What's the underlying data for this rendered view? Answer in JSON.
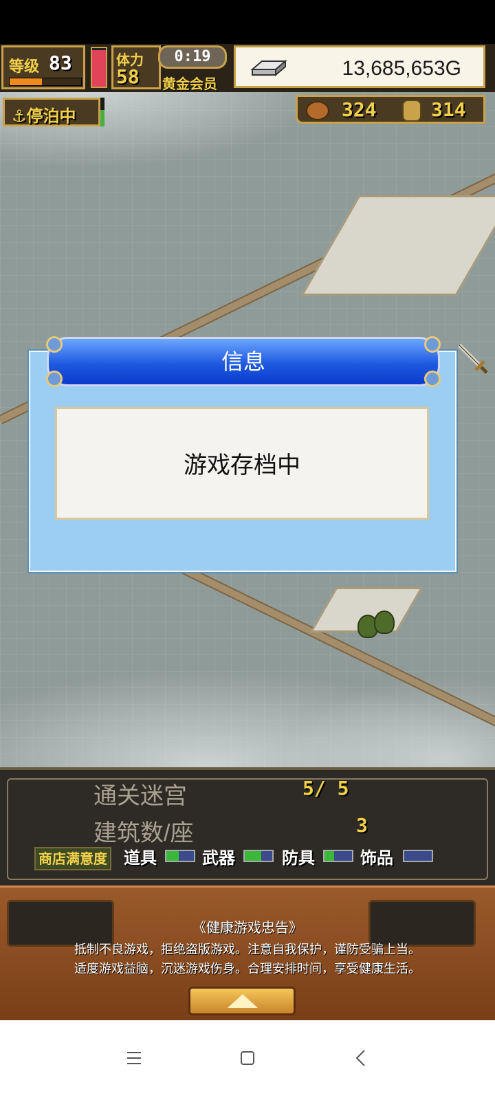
{
  "hud": {
    "level_label": "等级",
    "level": "83",
    "level_progress": 0.45,
    "hp_fraction": 0.95,
    "stamina_label": "体力",
    "stamina": "58",
    "timer": "0:19",
    "membership": "黄金会员",
    "gold": "13,685,653G",
    "dock_status": "停泊中",
    "resource1": "324",
    "resource2": "314",
    "colors": {
      "hud_gold": "#f1d04a",
      "hud_frame": "#c9a24a",
      "hp": "#e14358"
    }
  },
  "dialog": {
    "title": "信息",
    "message": "游戏存档中",
    "colors": {
      "title_bar": "#1f59e0",
      "panel": "#9ccdf2"
    }
  },
  "stats": {
    "cleared_dungeons_label": "通关迷宫",
    "cleared_dungeons": "5/ 5",
    "buildings_label": "建筑数/座",
    "buildings": "3",
    "shop_satisfaction_label": "商店满意度",
    "categories": [
      {
        "label": "道具",
        "level": 0.45
      },
      {
        "label": "武器",
        "level": 0.6
      },
      {
        "label": "防具",
        "level": 0.35
      },
      {
        "label": "饰品",
        "level": 0.0
      }
    ]
  },
  "notice": {
    "title": "《健康游戏忠告》",
    "line1": "抵制不良游戏，拒绝盗版游戏。注意自我保护，谨防受骗上当。",
    "line2": "适度游戏益脑，沉迷游戏伤身。合理安排时间，享受健康生活。"
  },
  "navbar": {
    "icons": [
      "menu-icon",
      "home-icon",
      "back-icon"
    ]
  }
}
